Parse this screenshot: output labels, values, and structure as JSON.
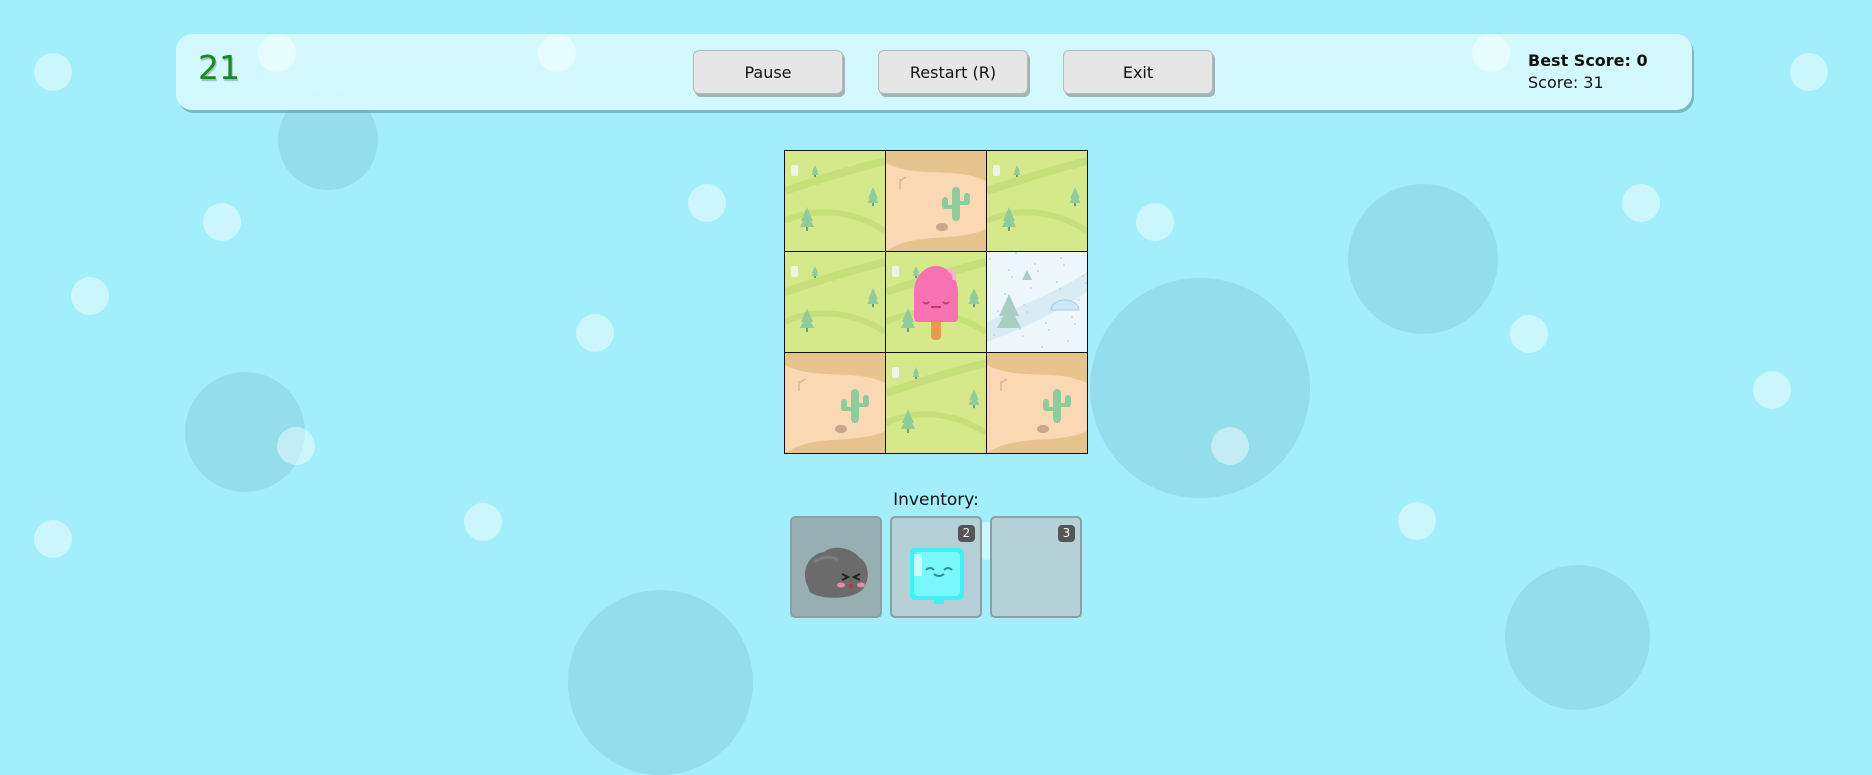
{
  "topbar": {
    "timer": "21",
    "buttons": {
      "pause": "Pause",
      "restart": "Restart (R)",
      "exit": "Exit"
    },
    "best_score": "Best Score: 0",
    "score": "Score: 31"
  },
  "board": {
    "rows": [
      [
        "grassland",
        "desert",
        "grassland"
      ],
      [
        "grassland",
        "grassland",
        "snow"
      ],
      [
        "desert",
        "grassland",
        "desert"
      ]
    ],
    "player": {
      "character": "popsicle-icon",
      "row": 1,
      "col": 1
    }
  },
  "inventory": {
    "label": "Inventory:",
    "slots": [
      {
        "item": "rock-icon",
        "badge": "",
        "selected": true
      },
      {
        "item": "ice-cube-icon",
        "badge": "2",
        "selected": false
      },
      {
        "item": "",
        "badge": "3",
        "selected": false
      }
    ]
  },
  "colors": {
    "background": "#a3eefb",
    "timer": "#178a24",
    "grass": "#d5e98a",
    "sand": "#fad8b4",
    "snow": "#edf6fb",
    "popsicle": "#f772b0"
  }
}
